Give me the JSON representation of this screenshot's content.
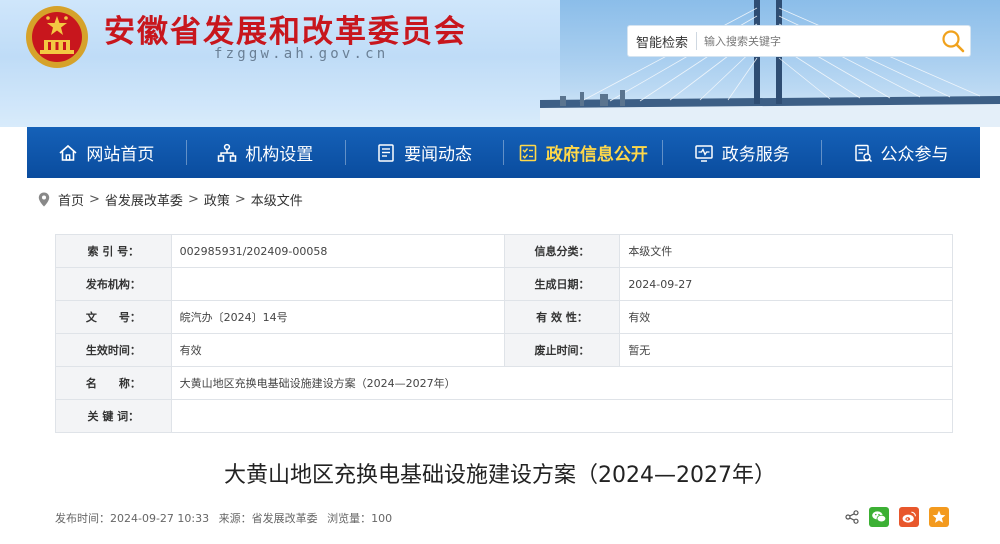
{
  "header": {
    "site_title": "安徽省发展和改革委员会",
    "site_domain": "fzggw.ah.gov.cn",
    "search_label": "智能检索",
    "search_placeholder": "输入搜索关键字"
  },
  "nav": {
    "items": [
      {
        "label": "网站首页",
        "icon": "home-icon"
      },
      {
        "label": "机构设置",
        "icon": "org-chart-icon"
      },
      {
        "label": "要闻动态",
        "icon": "newspaper-icon"
      },
      {
        "label": "政府信息公开",
        "icon": "checklist-icon",
        "active": true
      },
      {
        "label": "政务服务",
        "icon": "monitor-icon"
      },
      {
        "label": "公众参与",
        "icon": "feedback-icon"
      }
    ],
    "active_color": "#ffd84a"
  },
  "breadcrumb": [
    "首页",
    "省发展改革委",
    "政策",
    "本级文件"
  ],
  "meta": {
    "rows": [
      {
        "k1": "索 引 号：",
        "v1": "002985931/202409-00058",
        "k2": "信息分类：",
        "v2": "本级文件"
      },
      {
        "k1": "发布机构：",
        "v1": "",
        "k2": "生成日期：",
        "v2": "2024-09-27"
      },
      {
        "k1": "文　　号：",
        "v1": "皖汽办〔2024〕14号",
        "k2": "有 效 性：",
        "v2": "有效"
      },
      {
        "k1": "生效时间：",
        "v1": "有效",
        "k2": "废止时间：",
        "v2": "暂无"
      }
    ],
    "name_label": "名　　称：",
    "name_value": "大黄山地区充换电基础设施建设方案（2024—2027年）",
    "keywords_label": "关 键 词：",
    "keywords_value": ""
  },
  "article": {
    "title": "大黄山地区充换电基础设施建设方案（2024—2027年）",
    "publish_time": "发布时间：2024-09-27 10:33",
    "source": "来源：省发展改革委",
    "views": "浏览量：100"
  },
  "colors": {
    "title_red": "#c8161d",
    "nav_blue": "#0a4c9e",
    "wechat_green": "#3cb034",
    "weibo_orange": "#e8572c",
    "favorite_orange": "#f39a1e"
  }
}
